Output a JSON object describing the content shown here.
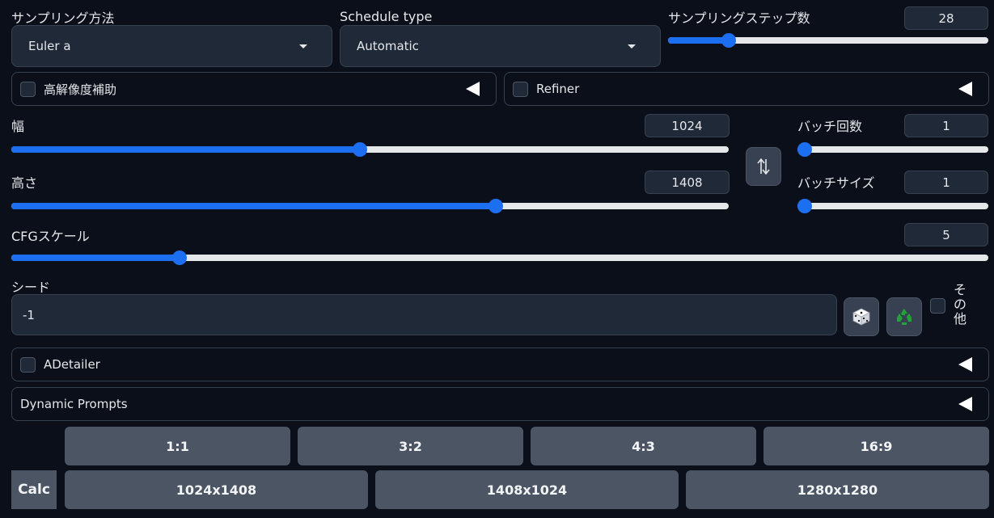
{
  "sampling": {
    "method_label": "サンプリング方法",
    "method_value": "Euler a",
    "schedule_label": "Schedule type",
    "schedule_value": "Automatic",
    "steps_label": "サンプリングステップ数",
    "steps_value": "28",
    "steps_fraction": 0.19
  },
  "hires": {
    "label": "高解像度補助"
  },
  "refiner": {
    "label": "Refiner"
  },
  "width": {
    "label": "幅",
    "value": "1024",
    "fraction": 0.486
  },
  "height": {
    "label": "高さ",
    "value": "1408",
    "fraction": 0.675
  },
  "batch_count": {
    "label": "バッチ回数",
    "value": "1",
    "fraction": 0.0
  },
  "batch_size": {
    "label": "バッチサイズ",
    "value": "1",
    "fraction": 0.0
  },
  "cfg": {
    "label": "CFGスケール",
    "value": "5",
    "fraction": 0.172
  },
  "seed": {
    "label": "シード",
    "value": "-1",
    "extra_label": "その他"
  },
  "adetailer": {
    "label": "ADetailer"
  },
  "dynamic_prompts": {
    "label": "Dynamic Prompts"
  },
  "ratio_buttons": [
    "1:1",
    "3:2",
    "4:3",
    "16:9"
  ],
  "size_buttons": [
    "1024x1408",
    "1408x1024",
    "1280x1280"
  ],
  "calc_label": "Calc",
  "colors": {
    "accent": "#1d6ff2",
    "background": "#0b0f19"
  }
}
